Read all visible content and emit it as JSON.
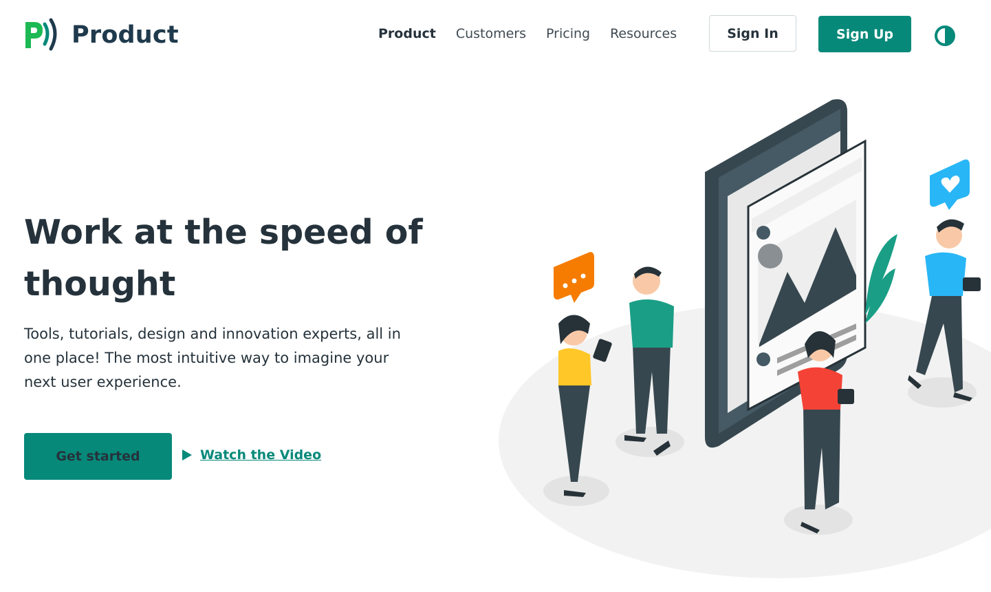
{
  "brand": {
    "name": "Product",
    "accent": "#07897a",
    "green": "#1db954",
    "dark": "#1f3a4c"
  },
  "nav": {
    "items": [
      {
        "label": "Product",
        "active": true
      },
      {
        "label": "Customers",
        "active": false
      },
      {
        "label": "Pricing",
        "active": false
      },
      {
        "label": "Resources",
        "active": false
      }
    ],
    "sign_in": "Sign In",
    "sign_up": "Sign Up",
    "theme_icon": "contrast-icon"
  },
  "hero": {
    "title": "Work at the speed of thought",
    "subtitle": "Tools, tutorials, design and innovation experts, all in one place! The most intuitive way to imagine your next user experience.",
    "cta_primary": "Get started",
    "cta_secondary": "Watch the Video",
    "cta_secondary_icon": "play-icon"
  },
  "illustration": {
    "icon": "people-with-phones-illustration",
    "colors": {
      "phone": "#37474f",
      "yellow": "#ffc727",
      "orange": "#f57c00",
      "teal": "#1a9e86",
      "blue": "#29b6f6",
      "red": "#f44336"
    }
  }
}
